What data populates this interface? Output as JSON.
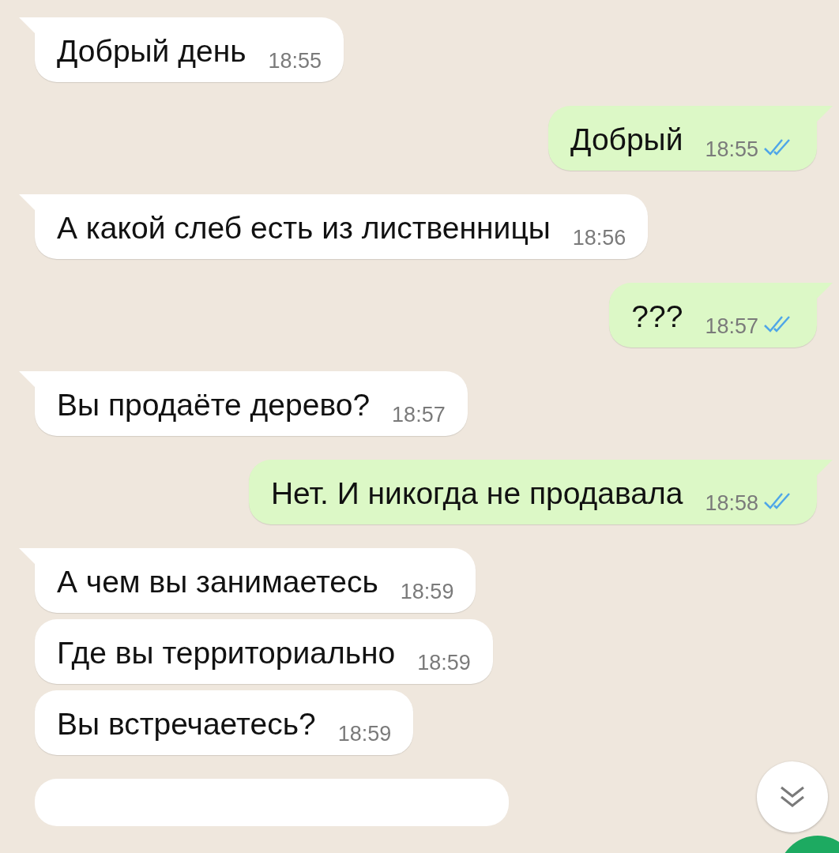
{
  "messages": [
    {
      "kind": "incoming",
      "text": "Добрый день",
      "time": "18:55",
      "tail": true
    },
    {
      "kind": "outgoing",
      "text": "Добрый",
      "time": "18:55",
      "tail": true,
      "read": true
    },
    {
      "kind": "incoming",
      "text": "А какой слеб есть из лиственницы",
      "time": "18:56",
      "tail": true
    },
    {
      "kind": "outgoing",
      "text": "???",
      "time": "18:57",
      "tail": true,
      "read": true
    },
    {
      "kind": "incoming",
      "text": "Вы продаёте дерево?",
      "time": "18:57",
      "tail": true
    },
    {
      "kind": "outgoing",
      "text": "Нет. И никогда не продавала",
      "time": "18:58",
      "tail": true,
      "read": true
    },
    {
      "kind": "incoming",
      "text": "А чем вы занимаетесь",
      "time": "18:59",
      "tail": true
    },
    {
      "kind": "incoming",
      "text": "Где вы территориально",
      "time": "18:59",
      "tail": false
    },
    {
      "kind": "incoming",
      "text": "Вы встречаетесь?",
      "time": "18:59",
      "tail": false
    }
  ]
}
